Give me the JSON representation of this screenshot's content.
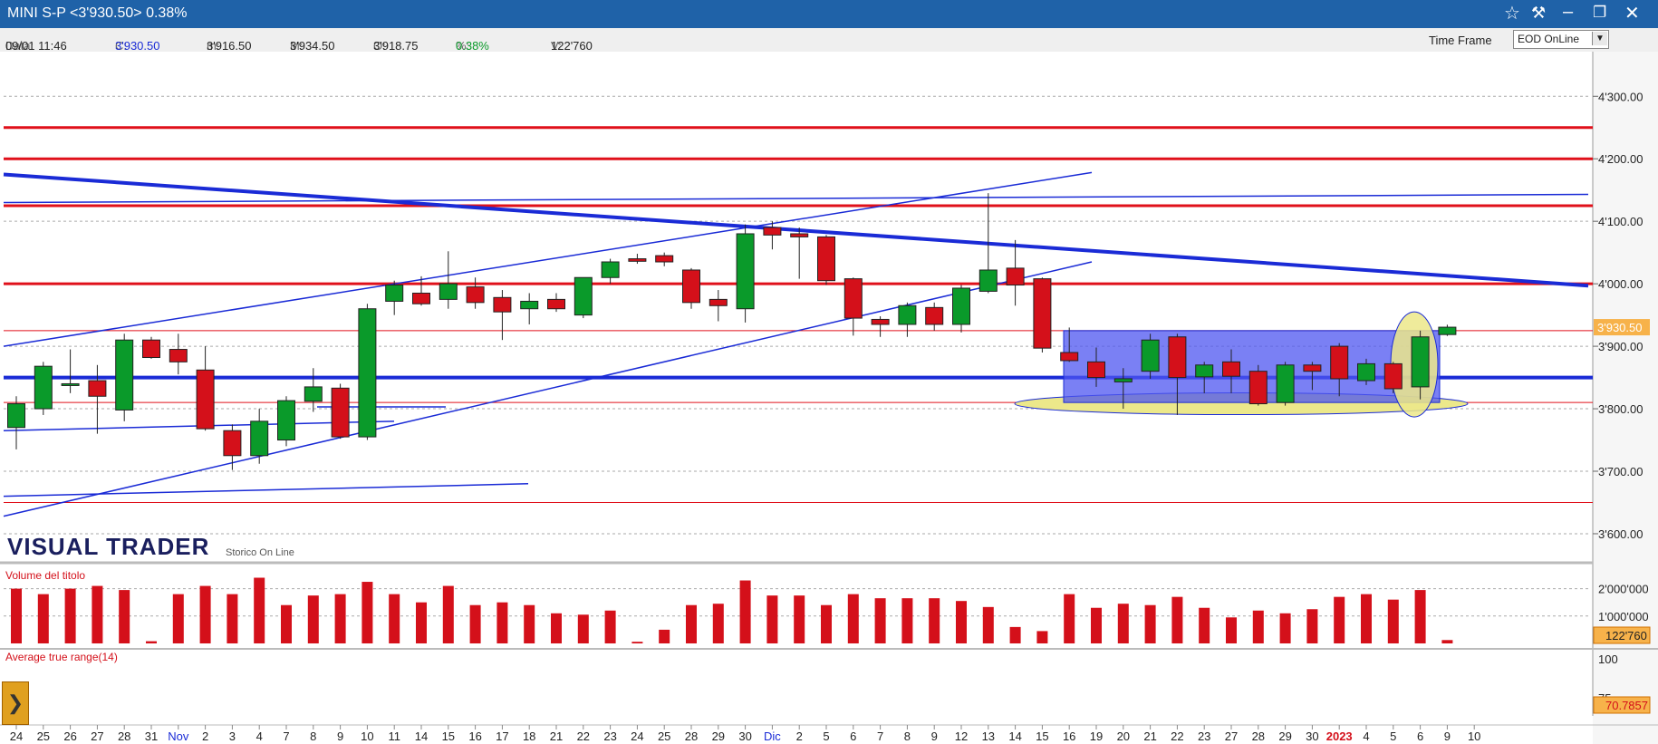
{
  "window": {
    "title": "MINI S-P  <3'930.50>  0.38%"
  },
  "info": {
    "data_label": "Data:",
    "data": "09/01 11:46",
    "close_label": "C:",
    "close": "3'930.50",
    "min_label": "m:",
    "min": "3'916.50",
    "max_label": "M:",
    "max": "3'934.50",
    "open_label": "O:",
    "open": "3'918.75",
    "pct_label": "%:",
    "pct": "0.38%",
    "vol_label": "V:",
    "vol": "122'760",
    "timeframe_label": "Time Frame",
    "timeframe_value": "EOD OnLine"
  },
  "branding": {
    "logo": "VISUAL TRADER",
    "sub": "Storico On Line"
  },
  "panels": {
    "volume_title": "Volume del titolo",
    "atr_title": "Average true range(14)"
  },
  "colors": {
    "up": "#0a9a2a",
    "down": "#d4101a",
    "trend": "#1a2bd6",
    "level": "#e0101a",
    "highlight": "#ece88a",
    "box": "#4d55f0",
    "title": "#1f62a8"
  },
  "chart_data": {
    "type": "candlestick",
    "x_labels": [
      "24",
      "25",
      "26",
      "27",
      "28",
      "31",
      "Nov",
      "2",
      "3",
      "4",
      "7",
      "8",
      "9",
      "10",
      "11",
      "14",
      "15",
      "16",
      "17",
      "18",
      "21",
      "22",
      "23",
      "24",
      "25",
      "28",
      "29",
      "30",
      "Dic",
      "2",
      "5",
      "6",
      "7",
      "8",
      "9",
      "12",
      "13",
      "14",
      "15",
      "16",
      "19",
      "20",
      "21",
      "22",
      "23",
      "27",
      "28",
      "29",
      "30",
      "2023",
      "4",
      "5",
      "6",
      "9",
      "10"
    ],
    "month_labels": [
      "Nov",
      "Dic",
      "2023"
    ],
    "candles": [
      {
        "o": 3770,
        "h": 3820,
        "l": 3735,
        "c": 3808
      },
      {
        "o": 3800,
        "h": 3875,
        "l": 3790,
        "c": 3868
      },
      {
        "o": 3840,
        "h": 3895,
        "l": 3825,
        "c": 3840
      },
      {
        "o": 3845,
        "h": 3870,
        "l": 3760,
        "c": 3820
      },
      {
        "o": 3798,
        "h": 3920,
        "l": 3780,
        "c": 3910
      },
      {
        "o": 3910,
        "h": 3915,
        "l": 3880,
        "c": 3882
      },
      {
        "o": 3895,
        "h": 3920,
        "l": 3855,
        "c": 3875
      },
      {
        "o": 3862,
        "h": 3900,
        "l": 3765,
        "c": 3768
      },
      {
        "o": 3765,
        "h": 3775,
        "l": 3702,
        "c": 3725
      },
      {
        "o": 3725,
        "h": 3800,
        "l": 3712,
        "c": 3780
      },
      {
        "o": 3750,
        "h": 3820,
        "l": 3740,
        "c": 3813
      },
      {
        "o": 3812,
        "h": 3865,
        "l": 3795,
        "c": 3835
      },
      {
        "o": 3833,
        "h": 3840,
        "l": 3752,
        "c": 3755
      },
      {
        "o": 3755,
        "h": 3968,
        "l": 3750,
        "c": 3960
      },
      {
        "o": 3972,
        "h": 4005,
        "l": 3950,
        "c": 3998
      },
      {
        "o": 3985,
        "h": 4012,
        "l": 3965,
        "c": 3968
      },
      {
        "o": 3975,
        "h": 4052,
        "l": 3960,
        "c": 4000
      },
      {
        "o": 3995,
        "h": 4010,
        "l": 3960,
        "c": 3970
      },
      {
        "o": 3978,
        "h": 3990,
        "l": 3910,
        "c": 3955
      },
      {
        "o": 3960,
        "h": 3985,
        "l": 3935,
        "c": 3972
      },
      {
        "o": 3975,
        "h": 3985,
        "l": 3955,
        "c": 3960
      },
      {
        "o": 3950,
        "h": 4010,
        "l": 3945,
        "c": 4010
      },
      {
        "o": 4010,
        "h": 4040,
        "l": 4000,
        "c": 4035
      },
      {
        "o": 4040,
        "h": 4048,
        "l": 4032,
        "c": 4036
      },
      {
        "o": 4045,
        "h": 4050,
        "l": 4028,
        "c": 4035
      },
      {
        "o": 4022,
        "h": 4025,
        "l": 3960,
        "c": 3970
      },
      {
        "o": 3975,
        "h": 3990,
        "l": 3940,
        "c": 3965
      },
      {
        "o": 3960,
        "h": 4095,
        "l": 3938,
        "c": 4080
      },
      {
        "o": 4090,
        "h": 4100,
        "l": 4055,
        "c": 4078
      },
      {
        "o": 4080,
        "h": 4090,
        "l": 4008,
        "c": 4075
      },
      {
        "o": 4075,
        "h": 4078,
        "l": 3998,
        "c": 4005
      },
      {
        "o": 4008,
        "h": 4010,
        "l": 3917,
        "c": 3945
      },
      {
        "o": 3943,
        "h": 3948,
        "l": 3915,
        "c": 3935
      },
      {
        "o": 3935,
        "h": 3970,
        "l": 3915,
        "c": 3965
      },
      {
        "o": 3962,
        "h": 3970,
        "l": 3925,
        "c": 3935
      },
      {
        "o": 3935,
        "h": 3998,
        "l": 3922,
        "c": 3993
      },
      {
        "o": 3988,
        "h": 4145,
        "l": 3985,
        "c": 4022
      },
      {
        "o": 4025,
        "h": 4070,
        "l": 3965,
        "c": 3998
      },
      {
        "o": 4008,
        "h": 4010,
        "l": 3890,
        "c": 3897
      },
      {
        "o": 3890,
        "h": 3930,
        "l": 3875,
        "c": 3877
      },
      {
        "o": 3875,
        "h": 3898,
        "l": 3835,
        "c": 3850
      },
      {
        "o": 3843,
        "h": 3865,
        "l": 3800,
        "c": 3848
      },
      {
        "o": 3860,
        "h": 3920,
        "l": 3848,
        "c": 3910
      },
      {
        "o": 3915,
        "h": 3920,
        "l": 3790,
        "c": 3850
      },
      {
        "o": 3851,
        "h": 3875,
        "l": 3825,
        "c": 3870
      },
      {
        "o": 3875,
        "h": 3895,
        "l": 3825,
        "c": 3852
      },
      {
        "o": 3860,
        "h": 3870,
        "l": 3805,
        "c": 3808
      },
      {
        "o": 3810,
        "h": 3875,
        "l": 3805,
        "c": 3870
      },
      {
        "o": 3870,
        "h": 3875,
        "l": 3830,
        "c": 3860
      },
      {
        "o": 3900,
        "h": 3905,
        "l": 3820,
        "c": 3848
      },
      {
        "o": 3845,
        "h": 3880,
        "l": 3838,
        "c": 3872
      },
      {
        "o": 3872,
        "h": 3875,
        "l": 3825,
        "c": 3832
      },
      {
        "o": 3835,
        "h": 3925,
        "l": 3815,
        "c": 3915
      },
      {
        "o": 3918.75,
        "h": 3934.5,
        "l": 3916.5,
        "c": 3930.5
      }
    ],
    "volumes": [
      2000000,
      1800000,
      2000000,
      2100000,
      1950000,
      80000,
      1800000,
      2100000,
      1800000,
      2400000,
      1400000,
      1750000,
      1800000,
      2250000,
      1800000,
      1500000,
      2100000,
      1400000,
      1500000,
      1400000,
      1100000,
      1050000,
      1200000,
      60000,
      500000,
      1400000,
      1450000,
      2300000,
      1750000,
      1750000,
      1400000,
      1800000,
      1650000,
      1650000,
      1650000,
      1550000,
      1330000,
      600000,
      450000,
      1800000,
      1300000,
      1450000,
      1400000,
      1700000,
      1300000,
      950000,
      1200000,
      1100000,
      1250000,
      1700000,
      1800000,
      1600000,
      1950000,
      122760
    ],
    "y_ticks": [
      "4'300.00",
      "4'200.00",
      "4'100.00",
      "4'000.00",
      "3'900.00",
      "3'800.00",
      "3'700.00",
      "3'600.00"
    ],
    "y_range": [
      3555,
      4370
    ],
    "vol_ticks": [
      "2'000'000",
      "1'000'000"
    ],
    "vol_range": [
      0,
      2450000
    ],
    "atr_ticks": [
      "100",
      "75"
    ],
    "price_badge": "3'930.50",
    "volume_badge": "122'760",
    "atr_badge": "70.7857",
    "horizontal_levels": [
      {
        "price": 4250,
        "kind": "red-thick"
      },
      {
        "price": 4200,
        "kind": "red-thick"
      },
      {
        "price": 4125,
        "kind": "red-thick"
      },
      {
        "price": 4000,
        "kind": "red-thick"
      },
      {
        "price": 3925,
        "kind": "red-thin"
      },
      {
        "price": 3810,
        "kind": "red-thin"
      },
      {
        "price": 3650,
        "kind": "red-thin"
      },
      {
        "price": 3850,
        "kind": "blue-thick"
      }
    ]
  }
}
